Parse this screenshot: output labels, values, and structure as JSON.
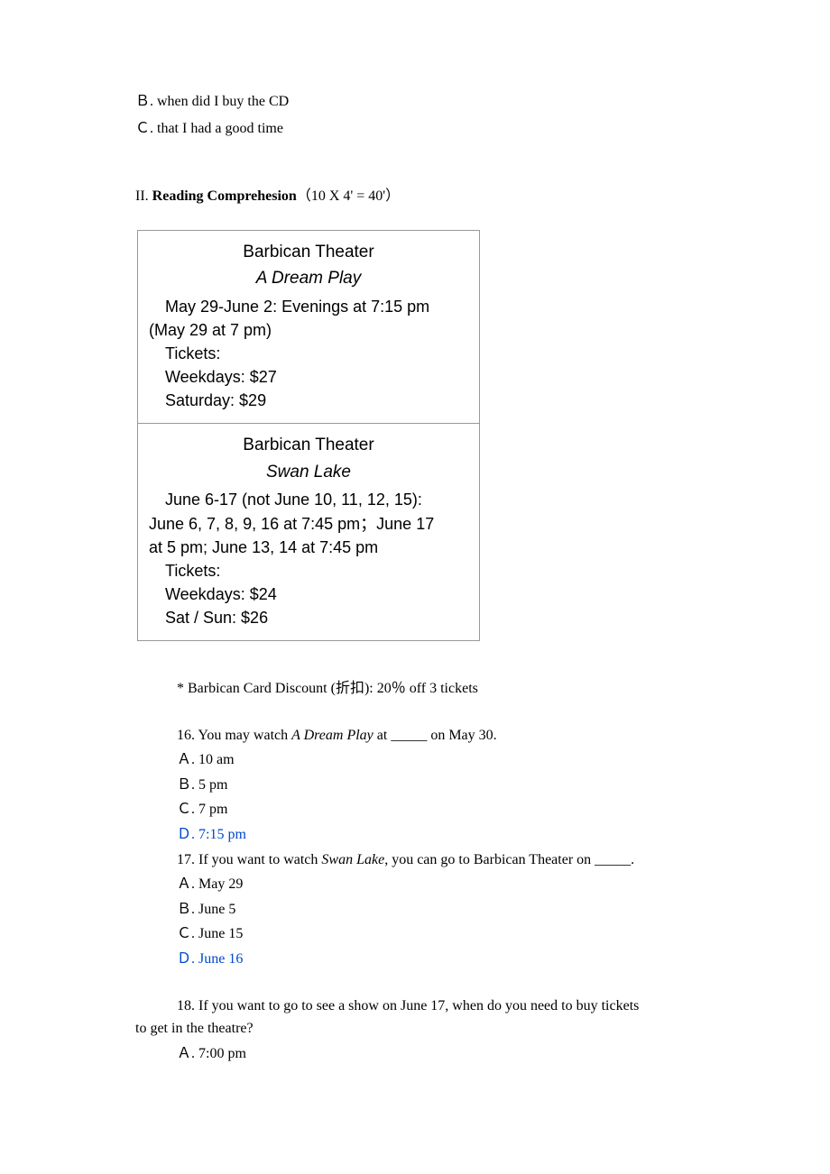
{
  "top_options": {
    "b": "Ｂ. when did I buy the CD",
    "c": "Ｃ. that I had a good time"
  },
  "section2": {
    "num": "II.",
    "bold": "Reading Comprehesion",
    "rest": "（10 X 4' = 40'）"
  },
  "box1": {
    "theater": "Barbican Theater",
    "play": "A Dream Play",
    "line1": "May 29-June 2: Evenings at 7:15 pm",
    "line2": "(May 29 at 7 pm)",
    "line3": "Tickets:",
    "line4": "Weekdays: $27",
    "line5": "Saturday: $29"
  },
  "box2": {
    "theater": "Barbican Theater",
    "play": "Swan Lake",
    "line1": "June 6-17 (not June 10, 11, 12, 15):",
    "line2": "June 6, 7, 8, 9, 16 at 7:45 pm；June 17",
    "line3": "at 5 pm;  June 13, 14 at 7:45 pm",
    "line4": "Tickets:",
    "line5": "Weekdays: $24",
    "line6": "Sat / Sun: $26"
  },
  "discount": "* Barbican Card Discount (折扣): 20％ off 3 tickets",
  "q16": {
    "stem_pre": "16. You may watch ",
    "stem_italic": "A Dream Play",
    "stem_post": " at _____ on May 30.",
    "a": "Ａ. 10 am",
    "b": "Ｂ. 5 pm",
    "c": "Ｃ. 7 pm",
    "d": "Ｄ. 7:15 pm"
  },
  "q17": {
    "stem_pre": "17. If you want to watch ",
    "stem_italic": "Swan Lake",
    "stem_post": ", you can go to Barbican Theater on _____.",
    "a": "Ａ. May 29",
    "b": "Ｂ. June 5",
    "c": "Ｃ. June 15",
    "d": "Ｄ. June 16"
  },
  "q18": {
    "line1": "18. If you want to go to see a show on June 17, when do you need to buy tickets",
    "line2": "to get in the theatre?",
    "a": "Ａ. 7:00 pm"
  }
}
